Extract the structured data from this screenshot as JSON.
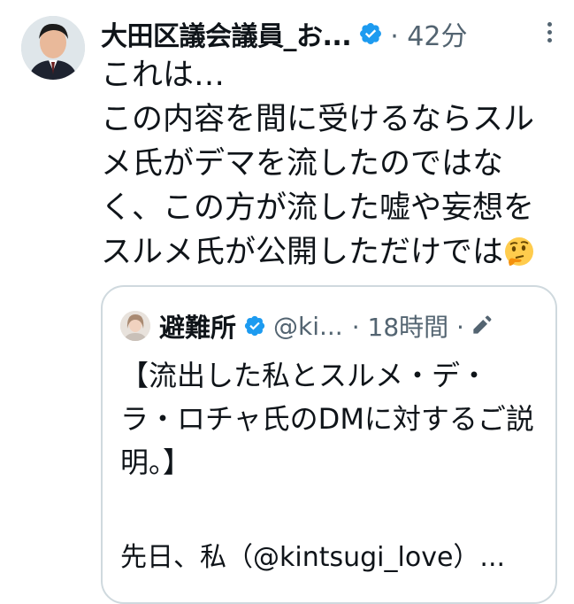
{
  "tweet": {
    "author_name": "大田区議会議員_お...",
    "time_meta": "· 42分",
    "text": "これは…\nこの内容を間に受けるならスルメ氏がデマを流したのではなく、この方が流した嘘や妄想をスルメ氏が公開しただけでは",
    "emoji": "thinking-face"
  },
  "quote": {
    "author_name": "避難所",
    "handle": "@ki...",
    "time_meta": "· 18時間 ·",
    "text": "【流出した私とスルメ・デ・ラ・ロチャ氏のDMに対するご説明。】",
    "text_continued": "先日、私（@kintsugi_love）..."
  },
  "colors": {
    "verified_blue": "#1d9bf0",
    "muted_text": "#536471",
    "border": "#cfd9de"
  },
  "icons": [
    "verified-badge-icon",
    "more-options-icon",
    "edit-icon",
    "thinking-face-emoji"
  ]
}
